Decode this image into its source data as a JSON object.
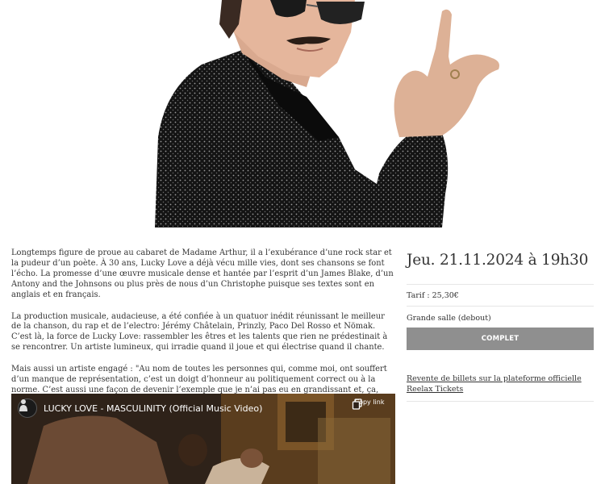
{
  "hero": {
    "image": "lucky-love-portrait-sunglasses-sequin-jacket-rock-hand"
  },
  "description": {
    "paragraphs": [
      "Longtemps figure de proue au cabaret de Madame Arthur, il a l’exubérance d’une rock star et la pudeur d’un poète. À 30 ans, Lucky Love a déjà vécu mille vies, dont ses chansons se font l’écho. La promesse d’une œuvre musicale dense et hantée par l’esprit d’un James Blake, d’un Antony and the Johnsons ou plus près de nous d’un Christophe puisque ses textes sont en anglais et en français.",
      "La production musicale, audacieuse, a été confiée à un quatuor inédit réunissant le meilleur de la chanson, du rap et de l’electro: Jérémy Châtelain, Prinzly, Paco Del Rosso et Nömak. C’est là, la force de Lucky Love: rassembler les êtres et les talents que rien ne prédestinait à se rencontrer. Un artiste lumineux, qui irradie quand il joue et qui électrise quand il chante.",
      "Mais aussi un artiste engagé : \"Au nom de toutes les personnes qui, comme moi, ont souffert d’un manque de représentation, c’est un doigt d’honneur au politiquement correct ou à la norme. C’est aussi une façon de devenir l’exemple que je n’ai pas eu en grandissant et, ça, c’est un cadeau merveilleux\"."
    ]
  },
  "video": {
    "title": "LUCKY LOVE - MASCULINITY (Official Music Video)",
    "copy_link_label": "Copy link"
  },
  "event": {
    "date": "Jeu. 21.11.2024 à 19h30",
    "tarif": "Tarif : 25,30€",
    "salle": "Grande salle (debout)",
    "status_button": "COMPLET",
    "resale_link": "Revente de billets sur la plateforme officielle Reelax Tickets"
  },
  "colors": {
    "button_bg": "#8f8f8f",
    "text": "#333333",
    "divider": "#e6e6e6"
  }
}
